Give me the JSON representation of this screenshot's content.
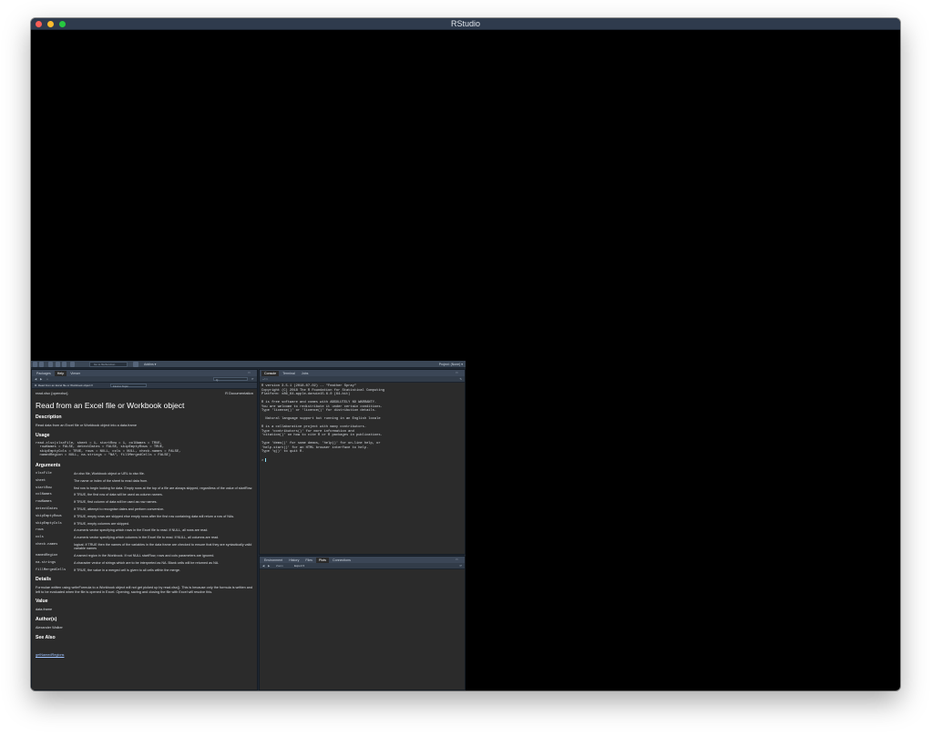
{
  "window": {
    "title": "RStudio"
  },
  "toolbar": {
    "goto_placeholder": "Go to file/function",
    "addins_label": "Addins ▾",
    "project_label": "Project: (None) ▾"
  },
  "help_pane": {
    "tabs": [
      "Packages",
      "Help",
      "Viewer"
    ],
    "active_tab": "Help",
    "topic_selector": "R: Read from an Excel file or Workbook object ▾",
    "find_placeholder": "Find in Topic",
    "search_placeholder": "Q",
    "header_left": "read.xlsx {openxlsx}",
    "header_right": "R Documentation",
    "title": "Read from an Excel file or Workbook object",
    "description_heading": "Description",
    "description_text": "Read data from an Excel file or Workbook object into a data.frame",
    "usage_heading": "Usage",
    "usage_code": "read.xlsx(xlsxFile, sheet = 1, startRow = 1, colNames = TRUE,\n  rowNames = FALSE, detectDates = FALSE, skipEmptyRows = TRUE,\n  skipEmptyCols = TRUE, rows = NULL, cols = NULL, check.names = FALSE,\n  namedRegion = NULL, na.strings = \"NA\", fillMergedCells = FALSE)",
    "arguments_heading": "Arguments",
    "arguments": [
      {
        "name": "xlsxFile",
        "desc": "An xlsx file, Workbook object or URL to xlsx file."
      },
      {
        "name": "sheet",
        "desc": "The name or index of the sheet to read data from."
      },
      {
        "name": "startRow",
        "desc": "first row to begin looking for data. Empty rows at the top of a file are always skipped, regardless of the value of startRow."
      },
      {
        "name": "colNames",
        "desc": "If TRUE, the first row of data will be used as column names."
      },
      {
        "name": "rowNames",
        "desc": "If TRUE, first column of data will be used as row names."
      },
      {
        "name": "detectDates",
        "desc": "If TRUE, attempt to recognise dates and perform conversion."
      },
      {
        "name": "skipEmptyRows",
        "desc": "If TRUE, empty rows are skipped else empty rows after the first row containing data will return a row of NAs."
      },
      {
        "name": "skipEmptyCols",
        "desc": "If TRUE, empty columns are skipped."
      },
      {
        "name": "rows",
        "desc": "A numeric vector specifying which rows in the Excel file to read. If NULL, all rows are read."
      },
      {
        "name": "cols",
        "desc": "A numeric vector specifying which columns in the Excel file to read. If NULL, all columns are read."
      },
      {
        "name": "check.names",
        "desc": "logical. If TRUE then the names of the variables in the data frame are checked to ensure that they are syntactically valid variable names"
      },
      {
        "name": "namedRegion",
        "desc": "A named region in the Workbook. If not NULL startRow, rows and cols parameters are ignored."
      },
      {
        "name": "na.strings",
        "desc": "A character vector of strings which are to be interpreted as NA. Blank cells will be returned as NA."
      },
      {
        "name": "fillMergedCells",
        "desc": "If TRUE, the value in a merged cell is given to all cells within the merge."
      }
    ],
    "details_heading": "Details",
    "details_text": "Formulae written using writeFormula to a Workbook object will not get picked up by read.xlsx(). This is because only the formula is written and left to be evaluated when the file is opened in Excel. Opening, saving and closing the file with Excel will resolve this.",
    "value_heading": "Value",
    "value_text": "data.frame",
    "authors_heading": "Author(s)",
    "authors_text": "Alexander Walker",
    "seealso_heading": "See Also",
    "seealso_link": "getNamedRegions"
  },
  "console_pane": {
    "tabs": [
      "Console",
      "Terminal",
      "Jobs"
    ],
    "active_tab": "Console",
    "path": "~/ ⇨",
    "lines": [
      "R version 3.5.1 (2018-07-02) -- \"Feather Spray\"",
      "Copyright (C) 2018 The R Foundation for Statistical Computing",
      "Platform: x86_64-apple-darwin15.6.0 (64-bit)",
      "",
      "R is free software and comes with ABSOLUTELY NO WARRANTY.",
      "You are welcome to redistribute it under certain conditions.",
      "Type 'license()' or 'licence()' for distribution details.",
      "",
      "  Natural language support but running in an English locale",
      "",
      "R is a collaborative project with many contributors.",
      "Type 'contributors()' for more information and",
      "'citation()' on how to cite R or R packages in publications.",
      "",
      "Type 'demo()' for some demos, 'help()' for on-line help, or",
      "'help.start()' for an HTML browser interface to help.",
      "Type 'q()' to quit R.",
      ""
    ],
    "prompt": ">"
  },
  "env_pane": {
    "tabs": [
      "Environment",
      "History",
      "Files",
      "Plots",
      "Connections"
    ],
    "active_tab": "Plots",
    "toolbar_items": [
      "Zoom",
      "Export ▾"
    ]
  }
}
